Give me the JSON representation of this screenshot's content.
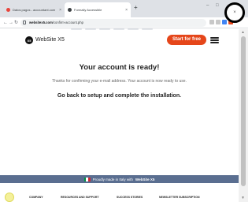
{
  "browser": {
    "tabs": [
      {
        "label": "Datos pagos - accountant.com",
        "favicon_color": "#e8453c",
        "close": "×"
      },
      {
        "label": "Formally Accessible",
        "favicon_color": "#3c4043",
        "close": "×"
      }
    ],
    "new_tab": "+",
    "window_controls": {
      "minimize": "–",
      "maximize": "□",
      "close": "×"
    },
    "nav": {
      "back": "←",
      "forward": "→",
      "reload": "↻"
    },
    "url_domain": "websitex5.com",
    "url_path": "/confirm-account.php",
    "toolbar_icon_colors": [
      "#c8c8c8",
      "#c8c8c8",
      "#4285f4",
      "#e5461a"
    ]
  },
  "site": {
    "logo_mark": "X5",
    "logo_text": "WebSite X5",
    "cta_label": "Start for free",
    "title": "Your account is ready!",
    "thanks": "Thanks for confirming your e-mail address. Your account is now ready to use.",
    "go_back": "Go back to setup and complete the installation.",
    "made_in_prefix": "Proudly made in Italy with",
    "made_in_brand": "WebSite X5",
    "footer_columns": [
      "COMPANY",
      "RESOURCES AND SUPPORT",
      "SUCCESS STORIES",
      "NEWSLETTER SUBSCRIPTION"
    ],
    "accent_color": "#e5461a"
  },
  "scroll": {
    "up": "▲",
    "down": "▼"
  },
  "overlay": {
    "close_glyph": "×"
  }
}
